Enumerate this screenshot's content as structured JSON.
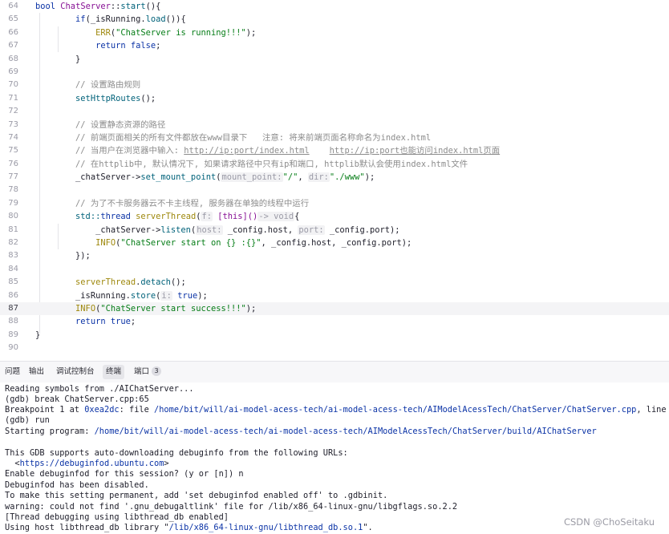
{
  "editor": {
    "line_numbers": [
      "64",
      "65",
      "66",
      "67",
      "68",
      "69",
      "70",
      "71",
      "72",
      "73",
      "74",
      "75",
      "76",
      "77",
      "78",
      "79",
      "80",
      "81",
      "82",
      "83",
      "84",
      "85",
      "86",
      "87",
      "88",
      "89",
      "90"
    ],
    "current_line": "87",
    "code": {
      "l64_kw": "bool",
      "l64_cls": "ChatServer",
      "l64_sep": "::",
      "l64_fn": "start",
      "l64_rest": "(){",
      "l65_kw": "if",
      "l65_a": "(_isRunning.",
      "l65_fn": "load",
      "l65_b": "()){",
      "l66_mac": "ERR",
      "l66_str": "\"ChatServer is running!!!\"",
      "l66_end": ");",
      "l67_kw": "return",
      "l67_kw2": "false",
      "l67_end": ";",
      "l68": "}",
      "l70_cmt": "// 设置路由规则",
      "l71_fn": "setHttpRoutes",
      "l71_end": "();",
      "l73_cmt": "// 设置静态资源的路径",
      "l74_cmt": "// 前端页面相关的所有文件都放在www目录下   注意: 将来前端页面名称命名为index.html",
      "l75_cmt_a": "// 当用户在浏览器中输入: ",
      "l75_link1": "http://ip:port/index.html",
      "l75_link2": "http://ip:port也能访问index.html页面",
      "l76_cmt": "// 在httplib中, 默认情况下, 如果请求路径中只有ip和端口, httplib默认会使用index.html文件",
      "l77_a": "_chatServer->",
      "l77_fn": "set_mount_point",
      "l77_hint1": "mount_point:",
      "l77_str1": "\"/\"",
      "l77_hint2": "dir:",
      "l77_str2": "\"./www\"",
      "l77_end": ");",
      "l79_cmt": "// 为了不卡服务器云不卡主线程, 服务器在单独的线程中运行",
      "l80_ns": "std::",
      "l80_type": "thread",
      "l80_var": "serverThread",
      "l80_hint": "f:",
      "l80_lam": "[this]()",
      "l80_arrow": "-> void",
      "l80_end": "{",
      "l81_a": "_chatServer->",
      "l81_fn": "listen",
      "l81_hint1": "host:",
      "l81_b": "_config.host,",
      "l81_hint2": "port:",
      "l81_c": "_config.port);",
      "l82_mac": "INFO",
      "l82_str": "\"ChatServer start on {} :{}\"",
      "l82_end": ", _config.host, _config.port);",
      "l83": "});",
      "l85_var": "serverThread",
      "l85_fn": "detach",
      "l85_end": "();",
      "l86_a": "_isRunning.",
      "l86_fn": "store",
      "l86_hint": "i:",
      "l86_kw": "true",
      "l86_end": ");",
      "l87_mac": "INFO",
      "l87_str": "\"ChatServer start success!!!\"",
      "l87_end": ");",
      "l88_kw": "return",
      "l88_kw2": "true",
      "l88_end": ";",
      "l89": "}"
    }
  },
  "panel_tabs": [
    {
      "label": "问题"
    },
    {
      "label": "输出"
    },
    {
      "label": "调试控制台"
    },
    {
      "label": "终端",
      "active": true
    },
    {
      "label": "端口",
      "badge": "3"
    }
  ],
  "terminal": {
    "lines": [
      "Reading symbols from ./AIChatServer...",
      "(gdb) break ChatServer.cpp:65",
      "Breakpoint 1 at ",
      "(gdb) run",
      "Starting program: ",
      "",
      "This GDB supports auto-downloading debuginfo from the following URLs:",
      "  <",
      "Enable debuginfod for this session? (y or [n]) n",
      "Debuginfod has been disabled.",
      "To make this setting permanent, add 'set debuginfod enabled off' to .gdbinit.",
      "warning: could not find '.gnu_debugaltlink' file for /lib/x86_64-linux-gnu/libgflags.so.2.2",
      "[Thread debugging using libthread_db enabled]",
      "Using host libthread_db library \""
    ],
    "bp_addr": "0xea2dc",
    "bp_file_prefix": ": file ",
    "bp_file_path": "/home/bit/will/ai-model-acess-tech/ai-model-acess-tech/AIModelAcessTech/ChatServer/ChatServer.cpp",
    "bp_line": ", line 65.",
    "program_path": "/home/bit/will/ai-model-acess-tech/ai-model-acess-tech/AIModelAcessTech/ChatServer/build/AIChatServer",
    "debuginfod_url": "https://debuginfod.ubuntu.com",
    "debuginfod_close": ">",
    "libthread_path": "/lib/x86_64-linux-gnu/libthread_db.so.1",
    "libthread_end": "\"."
  },
  "watermark": "CSDN @ChoSeitaku",
  "colors": {
    "keyword": "#0b33a6",
    "string": "#067d17",
    "comment": "#8c8c8c",
    "function": "#00627a",
    "macro": "#9e880d"
  }
}
